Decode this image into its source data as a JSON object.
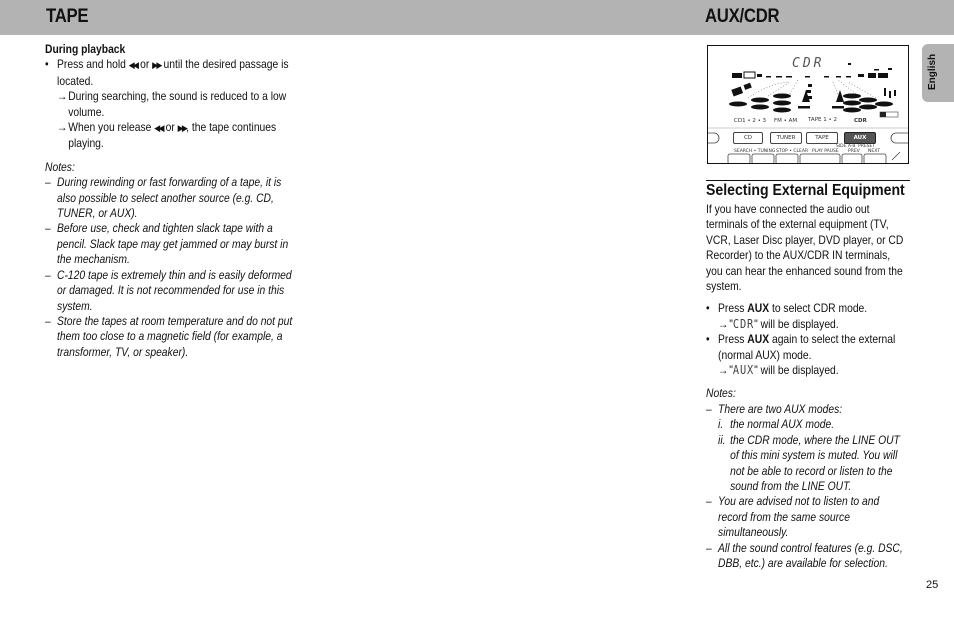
{
  "header": {
    "left_title": "TAPE",
    "right_title": "AUX/CDR"
  },
  "left": {
    "subhead": "During playback",
    "bullet1": {
      "pre": "Press and hold ",
      "rew_icon": "◀◀",
      "or": " or ",
      "ff_icon": "▶▶",
      "post": " until the desired passage is located."
    },
    "arrow1": "During searching, the sound is reduced to a low volume.",
    "arrow2": {
      "pre": "When you release ",
      "rew_icon": "◀◀",
      "or": " or ",
      "ff_icon": "▶▶",
      "post": ", the tape continues playing."
    },
    "notes_label": "Notes:",
    "notes": [
      "During rewinding or fast forwarding of a tape, it is also possible to select another source (e.g. CD, TUNER, or AUX).",
      "Before use, check and tighten slack tape with a pencil. Slack tape may get jammed or may burst in the mechanism.",
      "C-120 tape is extremely thin and is easily deformed or damaged.  It is not recommended for use in this system.",
      "Store the tapes at room temperature and do not put them too close to a magnetic field (for example, a transformer, TV, or speaker)."
    ]
  },
  "panel": {
    "display_text": "CDR",
    "source_labels": [
      "CD1 • 2 • 3",
      "FM • AM",
      "TAPE 1 • 2",
      "CDR"
    ],
    "buttons": [
      "CD",
      "TUNER",
      "TAPE",
      "AUX"
    ],
    "active_button": "AUX",
    "sub_labels": [
      "SEARCH • TUNING",
      "STOP • CLEAR",
      "SIDE A-B",
      "PLAY PAUSE",
      "PRESET",
      "PREV",
      "NEXT"
    ]
  },
  "lang_tab": "English",
  "right": {
    "section_title": "Selecting External Equipment",
    "intro": "If you have connected the audio out terminals of the external equipment (TV, VCR, Laser Disc player, DVD player, or CD Recorder) to the AUX/CDR IN terminals, you can hear the enhanced sound from the system.",
    "b1": {
      "pre": "Press ",
      "key": "AUX",
      "post": " to select CDR mode."
    },
    "a1": {
      "open": "\"",
      "lcd": "CDR",
      "close": "\" will be displayed."
    },
    "b2": {
      "pre": "Press ",
      "key": "AUX",
      "post": " again to select the external (normal AUX) mode."
    },
    "a2": {
      "open": "\"",
      "lcd": "AUX",
      "close": "\" will be displayed."
    },
    "notes_label": "Notes:",
    "note1": "There are two AUX modes:",
    "roman": [
      {
        "num": "i.",
        "text": "the normal AUX mode."
      },
      {
        "num": "ii.",
        "text": "the CDR mode, where the LINE OUT of this mini system is muted. You will not be able to record or listen to the sound from the LINE OUT."
      }
    ],
    "note2": "You are advised not to listen to and record from the same source simultaneously.",
    "note3": "All the sound control features (e.g. DSC, DBB, etc.) are available for selection."
  },
  "page_number": "25",
  "arrow_glyph": "→",
  "dash_glyph": "–"
}
